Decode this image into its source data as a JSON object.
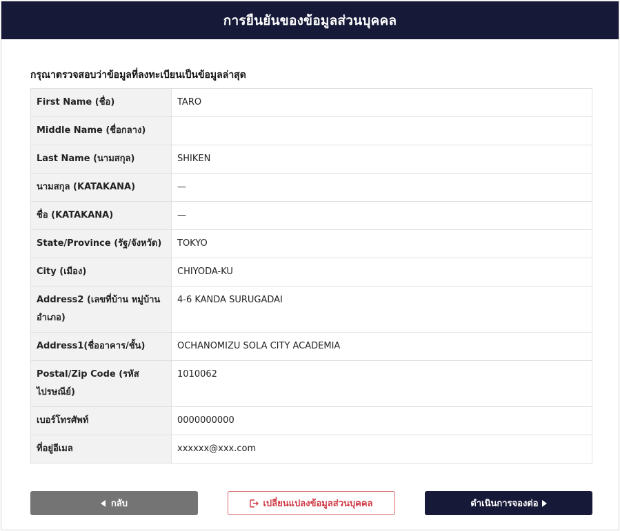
{
  "header": {
    "title": "การยืนยันของข้อมูลส่วนบุคคล"
  },
  "instruction": "กรุณาตรวจสอบว่าข้อมูลที่ลงทะเบียนเป็นข้อมูลล่าสุด",
  "fields": [
    {
      "label": "First Name (ชื่อ)",
      "value": "TARO"
    },
    {
      "label": "Middle Name (ชื่อกลาง)",
      "value": ""
    },
    {
      "label": "Last Name (นามสกุล)",
      "value": "SHIKEN"
    },
    {
      "label": "นามสกุล (KATAKANA)",
      "value": "—"
    },
    {
      "label": "ชื่อ (KATAKANA)",
      "value": "—"
    },
    {
      "label": "State/Province (รัฐ/จังหวัด)",
      "value": "TOKYO"
    },
    {
      "label": "City (เมือง)",
      "value": "CHIYODA-KU"
    },
    {
      "label": "Address2 (เลขที่บ้าน หมู่บ้าน อำเภอ)",
      "value": "4-6 KANDA SURUGADAI"
    },
    {
      "label": "Address1(ชื่ออาคาร/ชั้น)",
      "value": "OCHANOMIZU SOLA CITY ACADEMIA"
    },
    {
      "label": "Postal/Zip Code (รหัสไปรษณีย์)",
      "value": "1010062"
    },
    {
      "label": "เบอร์โทรศัพท์",
      "value": "0000000000"
    },
    {
      "label": "ที่อยู่อีเมล",
      "value": "xxxxxx@xxx.com"
    }
  ],
  "buttons": {
    "back": "กลับ",
    "change": "เปลี่ยนแปลงข้อมูลส่วนบุคคล",
    "next": "ดำเนินการจองต่อ"
  },
  "colors": {
    "header_bg": "#161a38",
    "back_bg": "#747474",
    "change_border": "#d9636a",
    "next_bg": "#161a38"
  },
  "icons": {
    "back": "caret-left-icon",
    "change": "edit-square-icon",
    "next": "caret-right-icon"
  }
}
